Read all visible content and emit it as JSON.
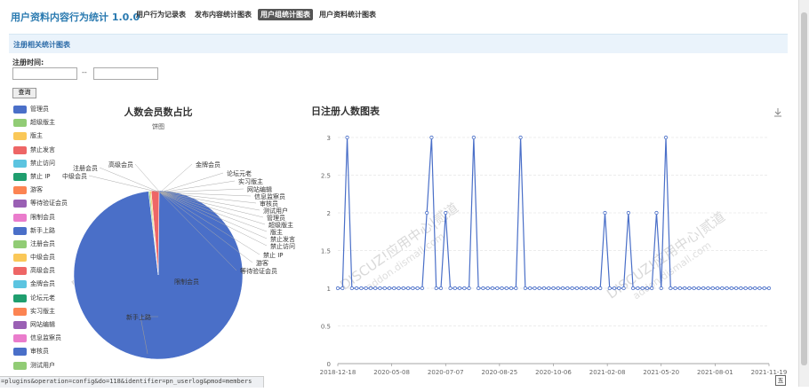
{
  "app": {
    "title": "用户资料内容行为统计 1.0.0"
  },
  "tabs": [
    {
      "label": "用户行为记录表",
      "active": false
    },
    {
      "label": "发布内容统计图表",
      "active": false
    },
    {
      "label": "用户组统计图表",
      "active": true
    },
    {
      "label": "用户资料统计图表",
      "active": false
    }
  ],
  "section": {
    "title": "注册相关统计图表"
  },
  "filter": {
    "label": "注册时间:",
    "start_value": "",
    "end_value": "",
    "separator": "--",
    "button_label": "查询"
  },
  "status_url": "=plugins&operation=config&do=118&identifier=pn_userlog&pmod=members",
  "watermark": {
    "text": "DISCUZ!应用中心|贰道",
    "subtext": "addon.dismall.com"
  },
  "colors": {
    "accent": "#2a7ab0",
    "pie_main": "#4a6fc8",
    "line": "#4a6fc8"
  },
  "chart_data": [
    {
      "type": "pie",
      "title": "人数会员数占比",
      "subtitle": "饼图",
      "legend_position": "left",
      "legend": [
        {
          "name": "管理员",
          "color": "#4a6fc8"
        },
        {
          "name": "超级版主",
          "color": "#91cc75"
        },
        {
          "name": "版主",
          "color": "#fac858"
        },
        {
          "name": "禁止发言",
          "color": "#ee6666"
        },
        {
          "name": "禁止访问",
          "color": "#5cc4e0"
        },
        {
          "name": "禁止 IP",
          "color": "#1f9e6e"
        },
        {
          "name": "游客",
          "color": "#fc8452"
        },
        {
          "name": "等待验证会员",
          "color": "#9a60b4"
        },
        {
          "name": "限制会员",
          "color": "#ea7ccc"
        },
        {
          "name": "新手上路",
          "color": "#4a6fc8"
        },
        {
          "name": "注册会员",
          "color": "#91cc75"
        },
        {
          "name": "中级会员",
          "color": "#fac858"
        },
        {
          "name": "高级会员",
          "color": "#ee6666"
        },
        {
          "name": "金牌会员",
          "color": "#5cc4e0"
        },
        {
          "name": "论坛元老",
          "color": "#1f9e6e"
        },
        {
          "name": "实习版主",
          "color": "#fc8452"
        },
        {
          "name": "网站编辑",
          "color": "#9a60b4"
        },
        {
          "name": "信息监察员",
          "color": "#ea7ccc"
        },
        {
          "name": "审核员",
          "color": "#4a6fc8"
        },
        {
          "name": "测试用户",
          "color": "#91cc75"
        }
      ],
      "slices": [
        {
          "name": "新手上路",
          "value": 98.0,
          "color": "#4a6fc8"
        },
        {
          "name": "高级会员",
          "value": 1.5,
          "color": "#ee6666"
        },
        {
          "name": "中级会员",
          "value": 0.25,
          "color": "#fac858"
        },
        {
          "name": "注册会员",
          "value": 0.25,
          "color": "#91cc75"
        }
      ],
      "slice_labels": [
        {
          "text": "高级会员"
        },
        {
          "text": "金牌会员"
        },
        {
          "text": "论坛元老"
        },
        {
          "text": "实习版主"
        },
        {
          "text": "网站编辑"
        },
        {
          "text": "信息监察员"
        },
        {
          "text": "审核员"
        },
        {
          "text": "测试用户"
        },
        {
          "text": "管理员"
        },
        {
          "text": "超级版主"
        },
        {
          "text": "版主"
        },
        {
          "text": "禁止发言"
        },
        {
          "text": "禁止访问"
        },
        {
          "text": "禁止 IP"
        },
        {
          "text": "游客"
        },
        {
          "text": "等待验证会员"
        },
        {
          "text": "注册会员"
        },
        {
          "text": "中级会员"
        },
        {
          "text": "限制会员"
        },
        {
          "text": "新手上路"
        }
      ]
    },
    {
      "type": "line",
      "title": "日注册人数图表",
      "toolbox": "download-icon",
      "ylim": [
        0,
        3
      ],
      "yticks": [
        0,
        0.5,
        1,
        1.5,
        2,
        2.5,
        3
      ],
      "xtick_labels": [
        "2018-12-18",
        "2020-05-08",
        "2020-07-07",
        "2020-08-25",
        "2020-10-06",
        "2021-02-08",
        "2021-05-20",
        "2021-08-01",
        "2021-11-19"
      ],
      "grid": true,
      "series": [
        {
          "values": [
            1,
            1,
            3,
            1,
            1,
            1,
            1,
            1,
            1,
            1,
            1,
            1,
            1,
            1,
            1,
            1,
            1,
            1,
            1,
            2,
            3,
            1,
            1,
            2,
            1,
            1,
            1,
            1,
            1,
            3,
            1,
            1,
            1,
            1,
            1,
            1,
            1,
            1,
            1,
            3,
            1,
            1,
            1,
            1,
            1,
            1,
            1,
            1,
            1,
            1,
            1,
            1,
            1,
            1,
            1,
            1,
            1,
            2,
            1,
            1,
            1,
            1,
            2,
            1,
            1,
            1,
            1,
            1,
            2,
            1,
            3,
            1,
            1,
            1,
            1,
            1,
            1,
            1,
            1,
            1,
            1,
            1,
            1,
            1,
            1,
            1,
            1,
            1,
            1,
            1,
            1,
            1,
            1
          ]
        }
      ]
    }
  ]
}
